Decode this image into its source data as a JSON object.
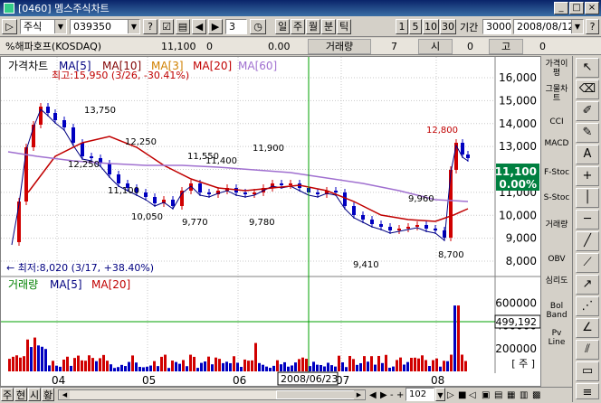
{
  "window": {
    "title": "[0460] 멤스주식차트"
  },
  "toolbar": {
    "market": "주식",
    "code": "039350",
    "question": "?",
    "check": "☑",
    "clock_label": "3",
    "periods": [
      "일",
      "주",
      "월",
      "분",
      "틱"
    ],
    "counts": [
      "1",
      "5",
      "10",
      "30"
    ],
    "period_label": "기간",
    "period_value": "3000",
    "date": "2008/08/12",
    "help": "?"
  },
  "info": {
    "name": "%해파호프(KOSDAQ)",
    "price": "11,100",
    "change": "0",
    "rate": "0.00",
    "volume_label": "거래량",
    "volume": "7",
    "open_label": "시",
    "open": "0",
    "high_label": "고",
    "high": "0"
  },
  "chart": {
    "price_title": "가격차트",
    "ma5": "MA[5]",
    "ma10": "MA[10]",
    "ma3": "MA[3]",
    "ma20": "MA[20]",
    "ma60": "MA[60]",
    "max_note": "최고:15,950 (3/26, -30.41%)",
    "min_note": "← 최저:8,020 (3/17, +38.40%)",
    "price_labels": [
      "13,750",
      "12,250",
      "12,250",
      "11,100",
      "10,050",
      "11,550",
      "11,400",
      "11,900",
      "9,770",
      "9,780",
      "9,960",
      "9,410",
      "8,700",
      "12,800"
    ],
    "y_ticks": [
      "16,000",
      "15,000",
      "14,000",
      "13,000",
      "12,000",
      "11,000",
      "10,000",
      "9,000",
      "8,000"
    ],
    "current_price": "11,100",
    "current_rate": "0.00%",
    "volume_title": "거래량",
    "vma5": "MA[5]",
    "vma20": "MA[20]",
    "v_ticks": [
      "600000",
      "400000",
      "200000"
    ],
    "v_cross": "499,192",
    "v_unit": "[ 주 ]",
    "x_ticks": [
      "04",
      "05",
      "06",
      "07",
      "08"
    ],
    "cross_date": "2008/06/23"
  },
  "right_panel": [
    "가격이평",
    "그물차트",
    "CCI",
    "MACD",
    "F-Stoc",
    "S-Stoc",
    "거래량",
    "OBV",
    "심리도",
    "Bol Band",
    "Pv Line"
  ],
  "bottom": {
    "tabs": [
      "주",
      "현",
      "시",
      "황"
    ],
    "zoom": "102"
  },
  "colors": {
    "up": "#d00000",
    "down": "#0000c0",
    "ma5": "#000080",
    "ma20": "#c00000",
    "ma60": "#a070d0"
  }
}
